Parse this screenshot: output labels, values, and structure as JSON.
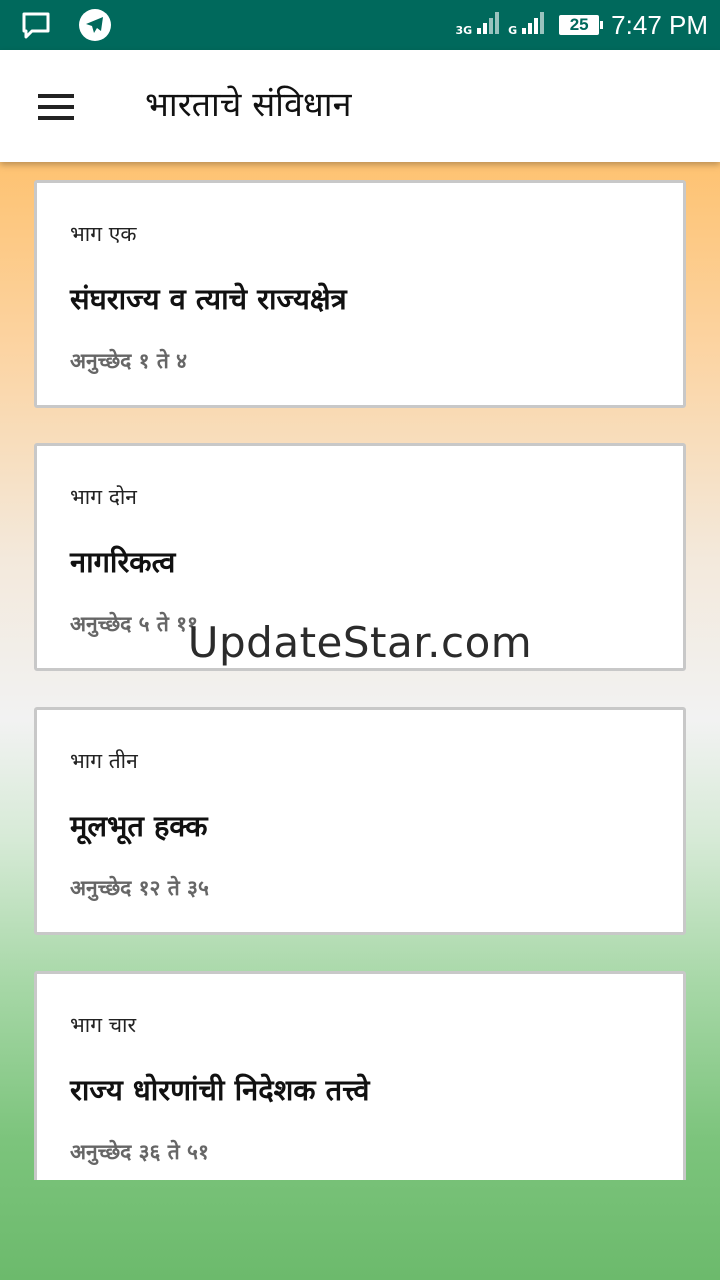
{
  "status_bar": {
    "time": "7:47 PM",
    "battery": "25",
    "network_1": "3G",
    "network_2": "G",
    "icons": [
      "message-icon",
      "telegram-icon",
      "signal-icon",
      "signal-icon",
      "battery-icon"
    ]
  },
  "app_bar": {
    "title": "भारताचे संविधान",
    "menu_icon": "hamburger-menu-icon"
  },
  "parts": [
    {
      "part": "भाग एक",
      "title": "संघराज्य व त्याचे राज्यक्षेत्र",
      "articles": "अनुच्छेद १ ते ४"
    },
    {
      "part": "भाग दोन",
      "title": "नागरिकत्व",
      "articles": "अनुच्छेद ५ ते ११"
    },
    {
      "part": "भाग तीन",
      "title": "मूलभूत हक्क",
      "articles": "अनुच्छेद १२ ते ३५"
    },
    {
      "part": "भाग चार",
      "title": "राज्य धोरणांची निदेशक तत्त्वे",
      "articles": "अनुच्छेद ३६ ते ५१"
    }
  ],
  "watermark": "UpdateStar.com",
  "colors": {
    "status_bar": "#00695c",
    "saffron": "#ffb347",
    "white": "#f2f2f2",
    "green": "#6cba6c"
  }
}
